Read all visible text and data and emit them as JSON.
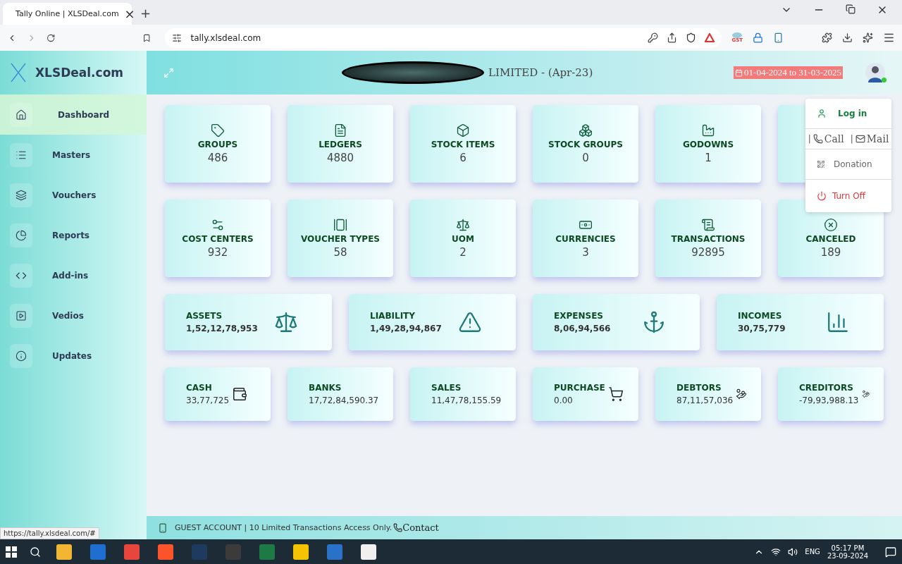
{
  "browser": {
    "tab_title": "Tally Online | XLSDeal.com",
    "tab_close": "×",
    "new_tab": "+",
    "url": "tally.xlsdeal.com",
    "extension_badge": "GST"
  },
  "brand": "XLSDeal.com",
  "header": {
    "company_suffix": "LIMITED",
    "period": "- (Apr-23)",
    "date_range": "01-04-2024 to 31-03-2025"
  },
  "sidebar": [
    {
      "label": "Dashboard",
      "selected": true
    },
    {
      "label": "Masters",
      "selected": false
    },
    {
      "label": "Vouchers",
      "selected": false
    },
    {
      "label": "Reports",
      "selected": false
    },
    {
      "label": "Add-ins",
      "selected": false
    },
    {
      "label": "Vedios",
      "selected": false
    },
    {
      "label": "Updates",
      "selected": false
    }
  ],
  "count_cards": [
    {
      "kind": "stat",
      "title": "GROUPS",
      "value": "486"
    },
    {
      "kind": "stat",
      "title": "LEDGERS",
      "value": "4880"
    },
    {
      "kind": "stat",
      "title": "STOCK ITEMS",
      "value": "6"
    },
    {
      "kind": "stat",
      "title": "STOCK GROUPS",
      "value": "0"
    },
    {
      "kind": "stat",
      "title": "GODOWNS",
      "value": "1"
    },
    {
      "kind": "covered"
    },
    {
      "kind": "stat",
      "title": "COST CENTERS",
      "value": "932"
    },
    {
      "kind": "stat",
      "title": "VOUCHER TYPES",
      "value": "58"
    },
    {
      "kind": "stat",
      "title": "UOM",
      "value": "2"
    },
    {
      "kind": "stat",
      "title": "CURRENCIES",
      "value": "3"
    },
    {
      "kind": "stat",
      "title": "TRANSACTIONS",
      "value": "92895"
    },
    {
      "kind": "stat",
      "title": "CANCELED",
      "value": "189"
    }
  ],
  "balance_cards": [
    {
      "title": "ASSETS",
      "value": "1,52,12,78,953"
    },
    {
      "title": "LIABILITY",
      "value": "1,49,28,94,867"
    },
    {
      "title": "EXPENSES",
      "value": "8,06,94,566"
    },
    {
      "title": "INCOMES",
      "value": "30,75,779"
    }
  ],
  "summary_cards": [
    {
      "title": "CASH",
      "value": "33,77,725"
    },
    {
      "title": "BANKS",
      "value": "17,72,84,590.37"
    },
    {
      "title": "SALES",
      "value": "11,47,78,155.59"
    },
    {
      "title": "PURCHASE",
      "value": "0.00"
    },
    {
      "title": "DEBTORS",
      "value": "87,11,57,036"
    },
    {
      "title": "CREDITORS",
      "value": "-79,93,988.13"
    }
  ],
  "user_menu": [
    {
      "kind": "login",
      "label": "Log in"
    },
    {
      "kind": "contact",
      "separator": "|",
      "call": "Call",
      "mail": "Mail"
    },
    {
      "kind": "donation",
      "label": "Donation"
    },
    {
      "kind": "power",
      "label": "Turn Off"
    }
  ],
  "footer": {
    "notice": "GUEST ACCOUNT | 10 Limited Transactions Access Only.",
    "contact": "Contact"
  },
  "status_url": "https://tally.xlsdeal.com/#",
  "taskbar": {
    "language": "ENG",
    "time": "05:17 PM",
    "date": "23-09-2024"
  }
}
